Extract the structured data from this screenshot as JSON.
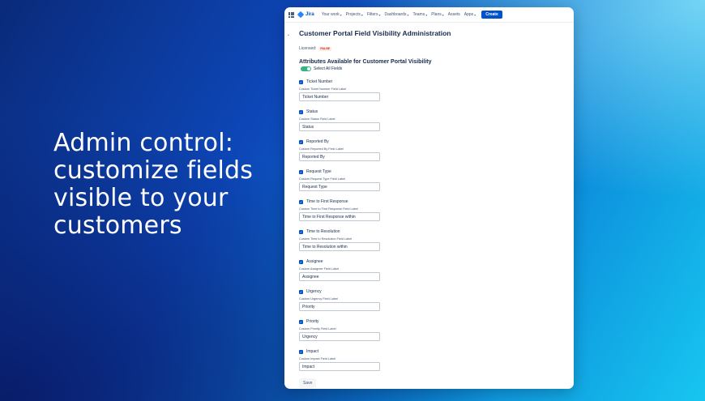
{
  "headline": [
    "Admin control:",
    "customize fields",
    "visible to your",
    "customers"
  ],
  "topbar": {
    "logo_text": "Jira",
    "nav": [
      {
        "label": "Your work",
        "chevron": true
      },
      {
        "label": "Projects",
        "chevron": true
      },
      {
        "label": "Filters",
        "chevron": true
      },
      {
        "label": "Dashboards",
        "chevron": true
      },
      {
        "label": "Teams",
        "chevron": true
      },
      {
        "label": "Plans",
        "chevron": true
      },
      {
        "label": "Assets",
        "chevron": false
      },
      {
        "label": "Apps",
        "chevron": true
      }
    ],
    "create_label": "Create"
  },
  "page": {
    "title": "Customer Portal Field Visibility Administration",
    "licensed_label": "Licensed:",
    "licensed_badge": "FALSE",
    "section_title": "Attributes Available for Customer Portal Visibility",
    "select_all_label": "Select All Fields",
    "fields": [
      {
        "name": "Ticket Number",
        "custom_label": "Custom Ticket Number Field Label",
        "value": "Ticket Number"
      },
      {
        "name": "Status",
        "custom_label": "Custom Status Field Label",
        "value": "Status"
      },
      {
        "name": "Reported By",
        "custom_label": "Custom Reported By Field Label",
        "value": "Reported By"
      },
      {
        "name": "Request Type",
        "custom_label": "Custom Request Type Field Label",
        "value": "Request Type"
      },
      {
        "name": "Time to First Response",
        "custom_label": "Custom Time to First Response Field Label",
        "value": "Time to First Response within"
      },
      {
        "name": "Time to Resolution",
        "custom_label": "Custom Time to Resolution Field Label",
        "value": "Time to Resolution within"
      },
      {
        "name": "Assignee",
        "custom_label": "Custom Assignee Field Label",
        "value": "Assignee"
      },
      {
        "name": "Urgency",
        "custom_label": "Custom Urgency Field Label",
        "value": "Priority"
      },
      {
        "name": "Priority",
        "custom_label": "Custom Priority Field Label",
        "value": "Urgency"
      },
      {
        "name": "Impact",
        "custom_label": "Custom Impact Field Label",
        "value": "Impact"
      }
    ],
    "save_label": "Save"
  },
  "colors": {
    "accent": "#0052cc",
    "toggle_on": "#36b37e",
    "badge_text": "#bf2600"
  }
}
